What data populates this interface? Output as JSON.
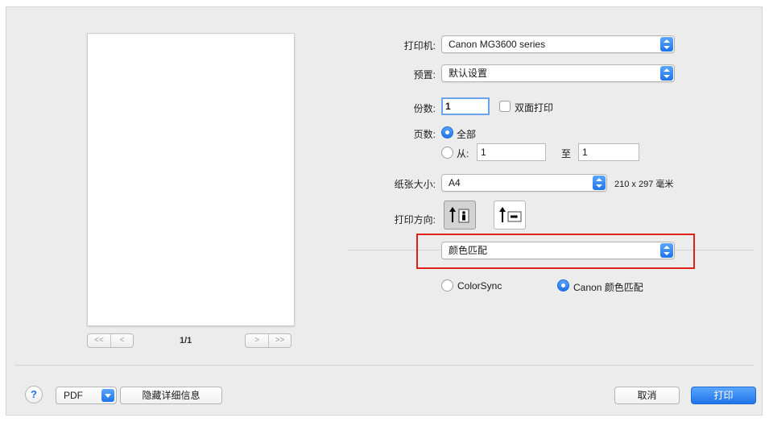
{
  "preview": {
    "page_count": "1/1",
    "nav_first": "<<",
    "nav_prev": "<",
    "nav_next": ">",
    "nav_last": ">>"
  },
  "printer": {
    "label": "打印机:",
    "value": "Canon MG3600 series"
  },
  "presets": {
    "label": "预置:",
    "value": "默认设置"
  },
  "copies": {
    "label": "份数:",
    "value": "1",
    "duplex_label": "双面打印",
    "duplex_checked": false
  },
  "pages": {
    "label": "页数:",
    "all_label": "全部",
    "from_label": "从:",
    "from_value": "1",
    "to_label": "至",
    "to_value": "1",
    "selected": "all"
  },
  "paper_size": {
    "label": "纸张大小:",
    "value": "A4",
    "dimensions": "210 x 297 毫米"
  },
  "orientation": {
    "label": "打印方向:",
    "selected": "portrait",
    "icons": [
      "portrait-icon",
      "landscape-icon"
    ]
  },
  "section": {
    "value": "颜色匹配",
    "highlight_color": "#e1201c"
  },
  "color_matching": {
    "options": [
      "ColorSync",
      "Canon 颜色匹配"
    ],
    "selected": "Canon 颜色匹配"
  },
  "footer": {
    "help": "?",
    "pdf": "PDF",
    "hide_details": "隐藏详细信息",
    "cancel": "取消",
    "print": "打印"
  },
  "colors": {
    "accent": "#1f74e8",
    "highlight": "#e1201c",
    "dialog_bg": "#ececec"
  }
}
